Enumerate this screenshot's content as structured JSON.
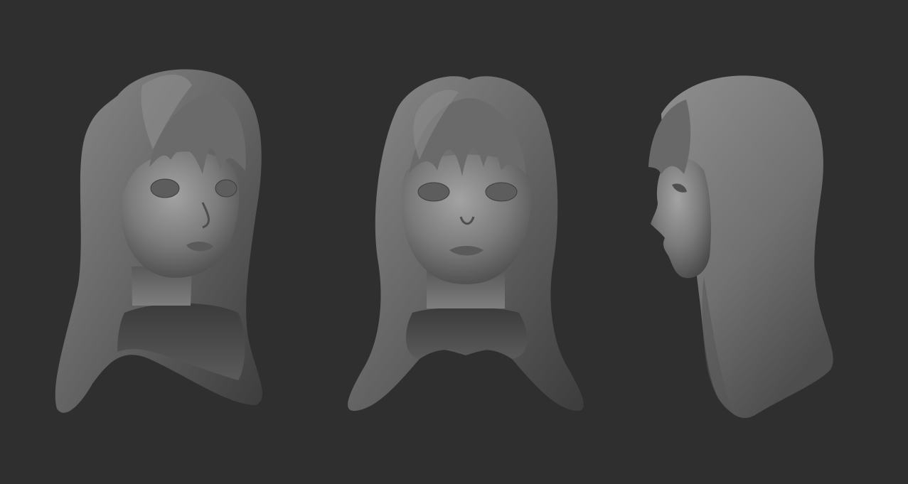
{
  "scene": {
    "background_color": "#2f2f2f",
    "material_colors": {
      "highlight": "#9a9a9a",
      "mid": "#6e6e6e",
      "shadow": "#3a3a3a",
      "deep": "#252525"
    },
    "views": [
      {
        "id": "three-quarter",
        "description_key": "three-quarter-view-bust"
      },
      {
        "id": "front",
        "description_key": "front-view-bust"
      },
      {
        "id": "side",
        "description_key": "side-view-bust"
      }
    ]
  }
}
